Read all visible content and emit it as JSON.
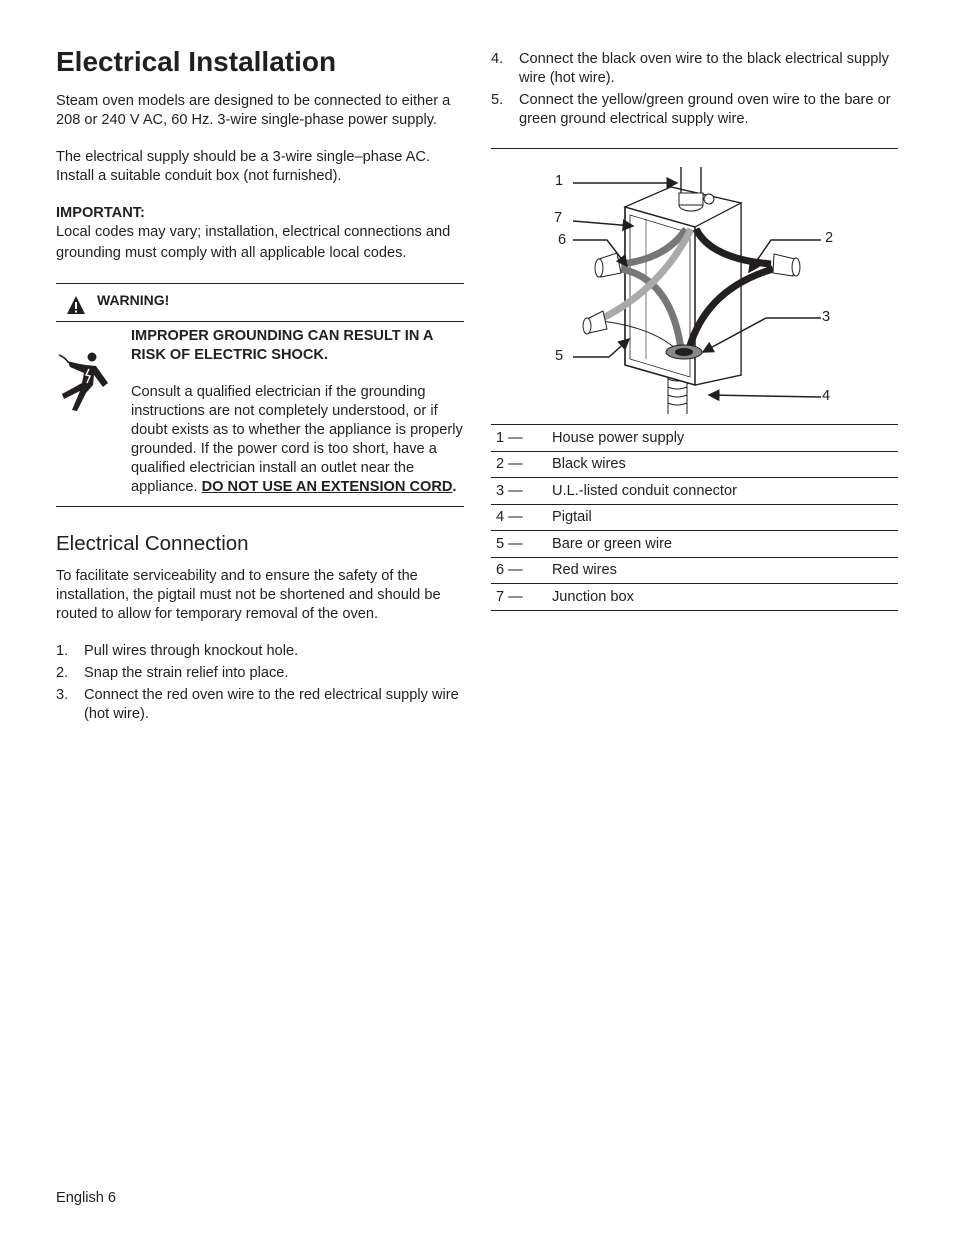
{
  "page": {
    "title": "Electrical Installation",
    "intro_paragraphs": [
      "Steam oven models are designed to be connected to either a 208 or 240 V AC, 60 Hz. 3-wire single-phase power supply.",
      "The electrical supply should be a 3-wire single–phase AC. Install a suitable conduit box (not furnished)."
    ],
    "important": {
      "label": "IMPORTANT:",
      "text": "Local codes may vary; installation, electrical connections and grounding must comply with all applicable local codes."
    },
    "warning": {
      "icon": "warning-triangle-icon",
      "label": "WARNING!",
      "shock_icon": "electric-shock-icon",
      "title": "IMPROPER GROUNDING CAN RESULT IN A RISK OF ELECTRIC SHOCK.",
      "text": "Consult a qualified electrician if the grounding instructions are not completely understood, or if doubt exists as to whether the appliance is properly grounded. If the power cord is too short, have a qualified electrician install an outlet near the appliance. ",
      "emphasis": "DO NOT USE AN EXTENSION CORD",
      "emphasis_suffix": "."
    },
    "connection": {
      "heading": "Electrical Connection",
      "paragraph": "To facilitate serviceability and to ensure the safety of the installation, the pigtail must not be shortened and should be routed to allow for temporary removal of the oven.",
      "steps": [
        {
          "num": "1.",
          "text": "Pull wires through knockout hole."
        },
        {
          "num": "2.",
          "text": "Snap the strain relief into place."
        },
        {
          "num": "3.",
          "text": "Connect the red oven wire to the red electrical supply wire (hot wire)."
        },
        {
          "num": "4.",
          "text": "Connect the black oven wire to the black electrical supply wire (hot wire)."
        },
        {
          "num": "5.",
          "text": "Connect the yellow/green ground oven wire to the bare or green ground electrical supply wire."
        }
      ]
    },
    "figure": {
      "callouts": [
        "1",
        "2",
        "3",
        "4",
        "5",
        "6",
        "7"
      ],
      "legend": [
        {
          "num": "1 —",
          "label": "House power supply"
        },
        {
          "num": "2 —",
          "label": "Black wires"
        },
        {
          "num": "3 —",
          "label": "U.L.-listed conduit connector"
        },
        {
          "num": "4 —",
          "label": "Pigtail"
        },
        {
          "num": "5 —",
          "label": "Bare or green wire"
        },
        {
          "num": "6 —",
          "label": "Red wires"
        },
        {
          "num": "7 —",
          "label": "Junction box"
        }
      ]
    },
    "footer": "English 6"
  }
}
